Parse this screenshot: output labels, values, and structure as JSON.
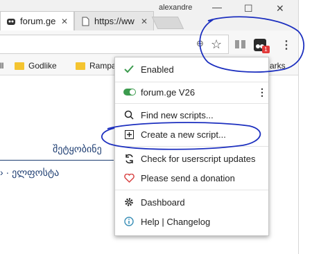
{
  "browser": {
    "tabs": [
      {
        "title": "forum.ge",
        "close": "✕"
      },
      {
        "title": "https://ww",
        "close": "✕"
      }
    ],
    "user": "alexandre",
    "window_controls": {
      "minimize": "—",
      "maximize": "☐",
      "close": "✕"
    },
    "bookmarks": [
      {
        "label": "ll"
      },
      {
        "label": "Godlike"
      },
      {
        "label": "Rampa"
      },
      {
        "label": "arks"
      }
    ],
    "extension_badge": "1"
  },
  "page": {
    "text_1": "შეტყობინე",
    "text_2": "› · ელფოსტა"
  },
  "menu": {
    "enabled": "Enabled",
    "script_name": "forum.ge V26",
    "find": "Find new scripts...",
    "create": "Create a new script...",
    "check": "Check for userscript updates",
    "donate": "Please send a donation",
    "dashboard": "Dashboard",
    "help": "Help | Changelog"
  },
  "colors": {
    "check": "#3c9b4e",
    "toggle_on": "#3c9b4e",
    "heart": "#d94545",
    "info": "#3a8fb7",
    "annotation": "#1c2fbf"
  }
}
